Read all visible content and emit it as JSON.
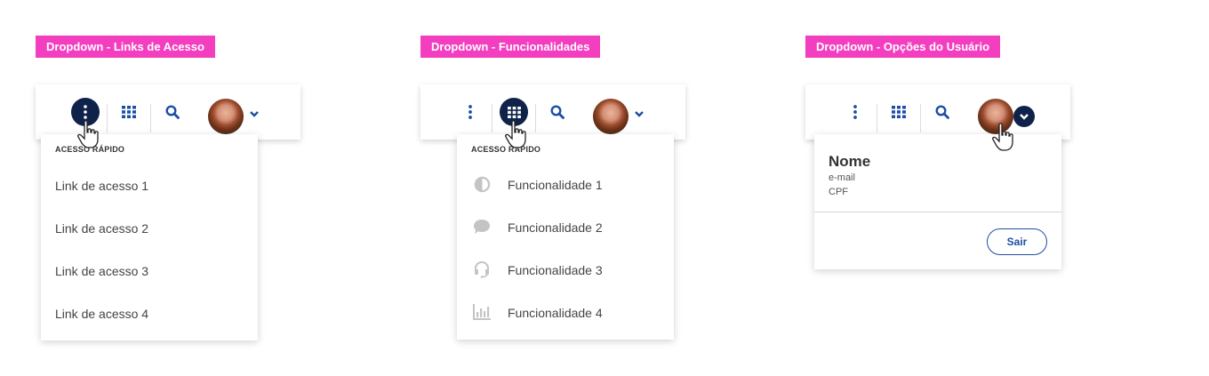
{
  "colors": {
    "tag": "#f43ec0",
    "navy": "#0f234a",
    "blue": "#1d4ea3",
    "icon_gray": "#c4c4c4"
  },
  "panels": [
    {
      "tag": "Dropdown - Links de Acesso",
      "menu_title": "ACESSO RÁPIDO",
      "items": [
        "Link de acesso 1",
        "Link de acesso 2",
        "Link de acesso 3",
        "Link de acesso 4"
      ]
    },
    {
      "tag": "Dropdown - Funcionalidades",
      "menu_title": "ACESSO RÁPIDO",
      "items": [
        {
          "label": "Funcionalidade 1",
          "icon": "contrast-icon"
        },
        {
          "label": "Funcionalidade 2",
          "icon": "chat-bubble-icon"
        },
        {
          "label": "Funcionalidade 3",
          "icon": "headset-icon"
        },
        {
          "label": "Funcionalidade 4",
          "icon": "bar-chart-icon"
        }
      ]
    },
    {
      "tag": "Dropdown - Opções do Usuário",
      "user": {
        "name": "Nome",
        "email": "e-mail",
        "cpf": "CPF"
      },
      "logout_label": "Sair"
    }
  ],
  "header_icons": [
    "more-vertical-icon",
    "apps-grid-icon",
    "search-icon",
    "avatar",
    "chevron-down-icon"
  ]
}
